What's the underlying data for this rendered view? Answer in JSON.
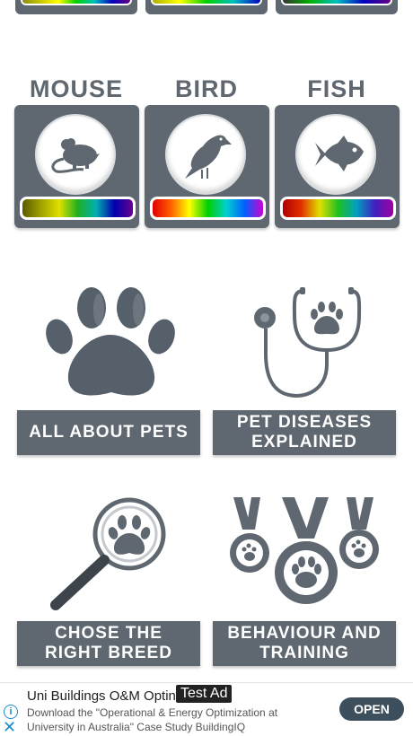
{
  "animals": [
    {
      "label": "MOUSE",
      "icon": "mouse-icon"
    },
    {
      "label": "BIRD",
      "icon": "bird-icon"
    },
    {
      "label": "FISH",
      "icon": "fish-icon"
    }
  ],
  "categories": [
    {
      "line1": "ALL ABOUT PETS",
      "line2": "",
      "icon": "paw-icon"
    },
    {
      "line1": "PET DISEASES",
      "line2": "EXPLAINED",
      "icon": "stethoscope-icon"
    },
    {
      "line1": "CHOSE THE",
      "line2": "RIGHT BREED",
      "icon": "magnifier-icon"
    },
    {
      "line1": "BEHAVIOUR AND",
      "line2": "TRAINING",
      "icon": "medals-icon"
    }
  ],
  "ad": {
    "title": "Uni Buildings O&M Optin",
    "badge": "Test Ad",
    "text": "Download the \"Operational & Energy Optimization at University in Australia\" Case Study BuildingIQ",
    "button": "OPEN"
  },
  "colors": {
    "tile": "#5f6870",
    "accent": "#1a8bd1"
  }
}
